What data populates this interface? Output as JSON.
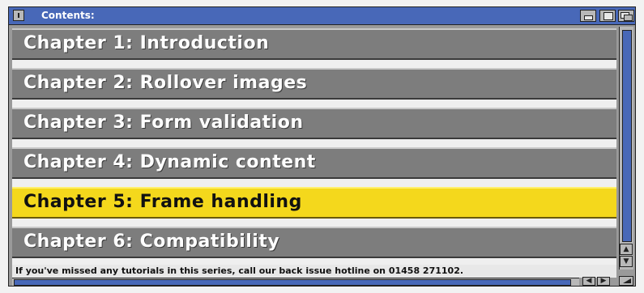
{
  "window": {
    "title": "Contents:"
  },
  "chapters": [
    {
      "label": "Chapter 1: Introduction",
      "active": false
    },
    {
      "label": "Chapter 2: Rollover images",
      "active": false
    },
    {
      "label": "Chapter 3: Form validation",
      "active": false
    },
    {
      "label": "Chapter 4: Dynamic content",
      "active": false
    },
    {
      "label": "Chapter 5: Frame handling",
      "active": true
    },
    {
      "label": "Chapter 6: Compatibility",
      "active": false
    }
  ],
  "footer": {
    "text": "If you've missed any tutorials in this series, call our back issue hotline on 01458 271102."
  },
  "icons": {
    "close": "close-icon",
    "iconify": "iconify-icon",
    "zoom": "zoom-icon",
    "depth": "depth-icon",
    "scroll_up": "arrow-up-icon",
    "scroll_down": "arrow-down-icon",
    "scroll_left": "arrow-left-icon",
    "scroll_right": "arrow-right-icon",
    "resize": "resize-icon"
  },
  "colors": {
    "titlebar": "#4868b8",
    "chapter_bg": "#7d7d7d",
    "active_bg": "#f4d81c",
    "frame": "#9a9a9a"
  }
}
